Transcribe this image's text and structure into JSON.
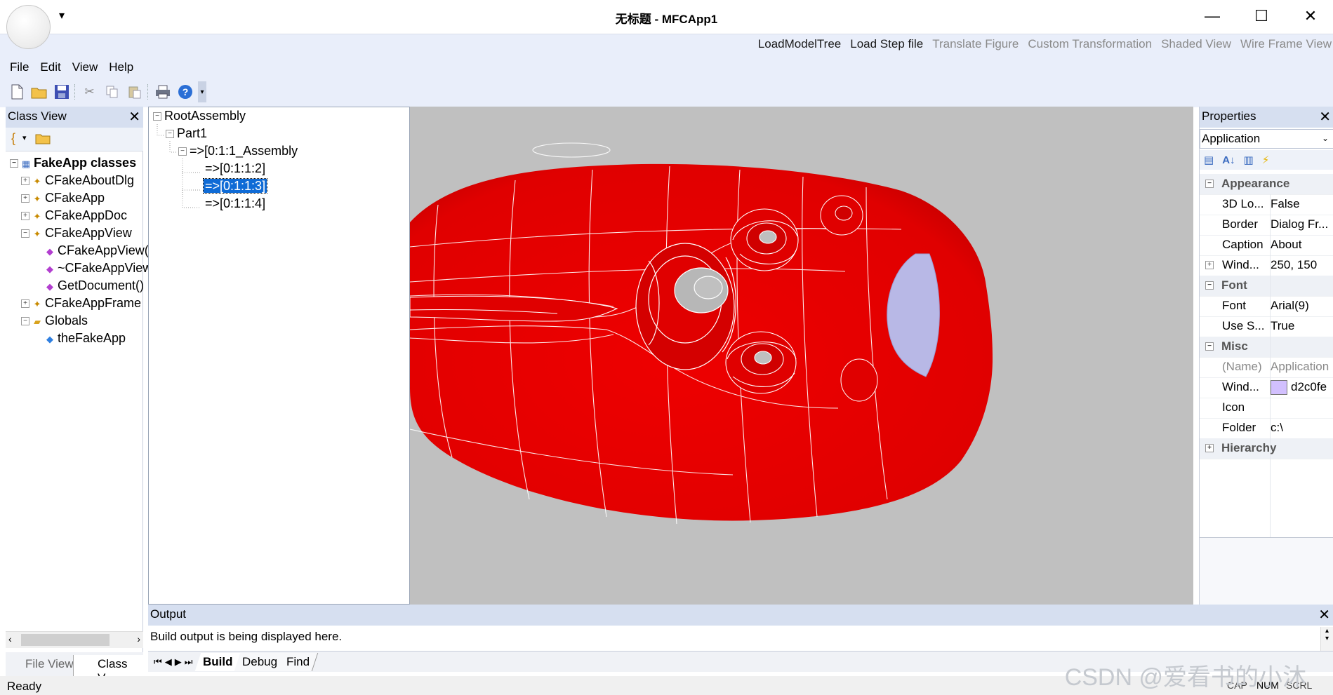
{
  "window": {
    "title": "无标题 - MFCApp1"
  },
  "ribbon": {
    "commands": [
      {
        "label": "LoadModelTree",
        "enabled": true
      },
      {
        "label": "Load Step file",
        "enabled": true
      },
      {
        "label": "Translate Figure",
        "enabled": false
      },
      {
        "label": "Custom Transformation",
        "enabled": false
      },
      {
        "label": "Shaded View",
        "enabled": false
      },
      {
        "label": "Wire Frame View",
        "enabled": false
      }
    ]
  },
  "menu": [
    "File",
    "Edit",
    "View",
    "Help"
  ],
  "toolbar_icons": [
    "new-file-icon",
    "open-folder-icon",
    "save-icon",
    "cut-icon",
    "copy-icon",
    "paste-icon",
    "print-icon",
    "help-icon"
  ],
  "class_view": {
    "title": "Class View",
    "root": "FakeApp classes",
    "items": [
      "CFakeAboutDlg",
      "CFakeApp",
      "CFakeAppDoc",
      "CFakeAppView",
      "CFakeAppView()",
      "~CFakeAppView()",
      "GetDocument()",
      "CFakeAppFrame",
      "Globals",
      "theFakeApp"
    ]
  },
  "assembly_tree": {
    "root": "RootAssembly",
    "part": "Part1",
    "assembly": "=>[0:1:1_Assembly",
    "children": [
      "=>[0:1:1:2]",
      "=>[0:1:1:3]",
      "=>[0:1:1:4]"
    ],
    "selected": "=>[0:1:1:3]"
  },
  "properties": {
    "title": "Properties",
    "object": "Application",
    "categories": {
      "appearance": "Appearance",
      "font": "Font",
      "misc": "Misc",
      "hierarchy": "Hierarchy"
    },
    "rows": {
      "r1_k": "3D Lo...",
      "r1_v": "False",
      "r2_k": "Border",
      "r2_v": "Dialog Fr...",
      "r3_k": "Caption",
      "r3_v": "About",
      "r4_k": "Wind...",
      "r4_v": "250, 150",
      "r5_k": "Font",
      "r5_v": "Arial(9)",
      "r6_k": "Use S...",
      "r6_v": "True",
      "r7_k": "(Name)",
      "r7_v": "Application",
      "r8_k": "Wind...",
      "r8_v": "d2c0fe",
      "r9_k": "Icon",
      "r9_v": "",
      "r10_k": "Folder",
      "r10_v": "c:\\"
    },
    "swatch_color": "#d2c0fe"
  },
  "output": {
    "title": "Output",
    "line": "Build output is being displayed here.",
    "tabs": [
      "Build",
      "Debug",
      "Find"
    ],
    "active_tab": "Build"
  },
  "left_tabs": [
    "File View",
    "Class V..."
  ],
  "status": {
    "text": "Ready",
    "cap": "CAP",
    "num": "NUM",
    "scrl": "SCRL"
  },
  "watermark": "CSDN @爱看书的小沐",
  "colors": {
    "model": "#ee0000",
    "wire": "#ffffff",
    "endcap": "#b8b8e6",
    "viewport_bg": "#c0c0c0"
  }
}
